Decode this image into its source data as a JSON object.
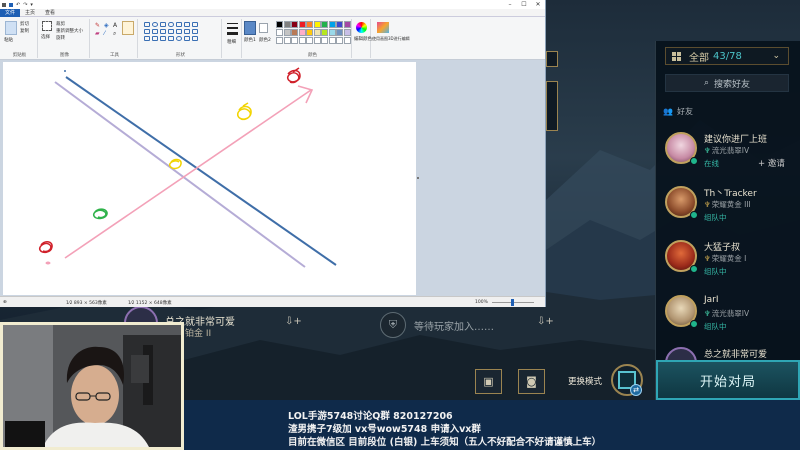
{
  "paint": {
    "tabs": [
      "文件",
      "主页",
      "查看"
    ],
    "ribbon_labels": {
      "clipboard": "剪贴板",
      "image": "图像",
      "tools": "工具",
      "shapes": "形状",
      "colors": "颜色",
      "paste": "粘贴",
      "cut": "剪切",
      "copy": "复制",
      "crop": "裁剪",
      "resize": "重新调整大小",
      "rotate": "旋转",
      "select": "选择",
      "size": "粗细",
      "color1": "颜色1",
      "color2": "颜色2",
      "edit_colors": "编辑颜色",
      "paint3d": "使用画图3D进行编辑"
    },
    "palette": [
      "#000000",
      "#7f7f7f",
      "#880015",
      "#ed1c24",
      "#ff7f27",
      "#fff200",
      "#22b14c",
      "#00a2e8",
      "#3f48cc",
      "#a349a4",
      "#ffffff",
      "#c3c3c3",
      "#b97a57",
      "#ffaec9",
      "#ffc90e",
      "#efe4b0",
      "#b5e61d",
      "#99d9ea",
      "#7092be",
      "#c8bfe7"
    ],
    "status": {
      "left": "⊕",
      "selection": "1⁄2 893 × 563像素",
      "canvas_size": "1⁄2 1152 × 648像素",
      "zoom": "100%"
    },
    "drawing_colors": {
      "blue_line": "#3f6ea8",
      "lavender_line": "#b5acd6",
      "pink_arrow": "#f3a1b8",
      "red": "#d0202a",
      "yellow": "#f2d400",
      "green": "#2fb24a"
    }
  },
  "friends": {
    "filter_label": "全部",
    "filter_count": "43/78",
    "search_label": "搜索好友",
    "header": "好友",
    "list": [
      {
        "name": "建议你进厂上班",
        "rank": "流光翡翠IV",
        "status": "在线",
        "invite": "邀请"
      },
      {
        "name": "Th丶Tracker",
        "rank": "荣耀黄金 III",
        "status": "组队中",
        "invite": ""
      },
      {
        "name": "大猛子叔",
        "rank": "荣耀黄金 I",
        "status": "组队中",
        "invite": ""
      },
      {
        "name": "JarI",
        "rank": "流光翡翠IV",
        "status": "组队中",
        "invite": ""
      },
      {
        "name": "总之就非常可爱",
        "rank": "",
        "status": "",
        "invite": ""
      }
    ],
    "play_button": "开始对局"
  },
  "lobby": {
    "player_name": "总之就非常可爱",
    "player_rank": "铂金 II",
    "waiting_text": "等待玩家加入……",
    "mode_label": "更换模式"
  },
  "captions": [
    "LOL手游5748讨论Q群 820127206",
    "渣男携子7级加  vx号wow5748    申请入vx群",
    "目前在微信区  目前段位 (白银) 上车须知（五人不好配合不好请谨慎上车）"
  ]
}
